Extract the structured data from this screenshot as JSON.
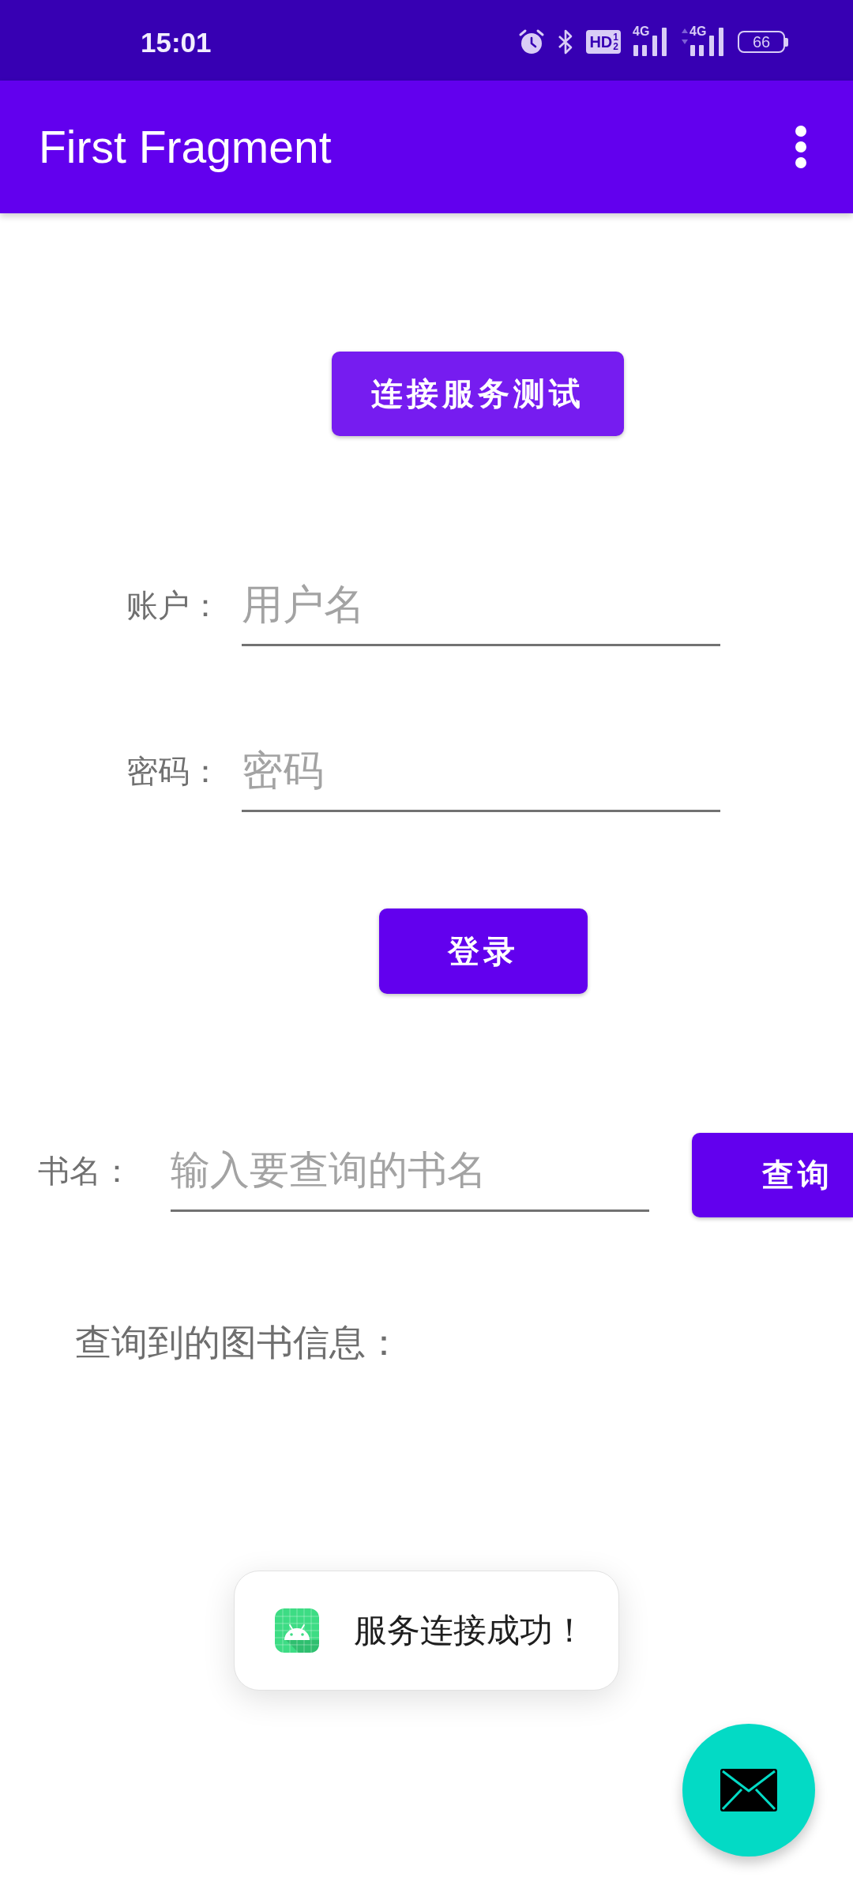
{
  "status_bar": {
    "time": "15:01",
    "hd_badge": {
      "label": "HD",
      "sims": [
        "1",
        "2"
      ]
    },
    "networks": [
      {
        "type": "4G",
        "activity": false
      },
      {
        "type": "4G",
        "activity": true
      }
    ],
    "battery": "66"
  },
  "app_bar": {
    "title": "First Fragment"
  },
  "connect_button": "连接服务测试",
  "login_form": {
    "fields": [
      {
        "label": "账户：",
        "placeholder": "用户名"
      },
      {
        "label": "密码：",
        "placeholder": "密码"
      }
    ],
    "submit": "登录"
  },
  "book_search": {
    "label": "书名：",
    "placeholder": "输入要查询的书名",
    "button": "查询"
  },
  "result": {
    "label": "查询到的图书信息："
  },
  "toast": {
    "message": "服务连接成功！"
  }
}
